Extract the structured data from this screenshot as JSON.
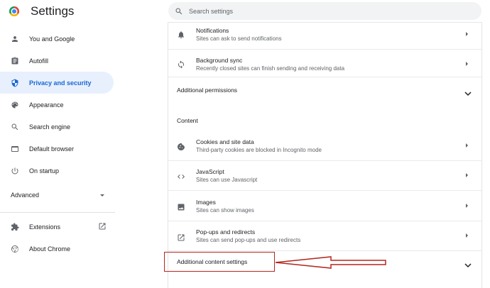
{
  "header": {
    "title": "Settings",
    "search_placeholder": "Search settings"
  },
  "sidebar": {
    "items": [
      {
        "label": "You and Google",
        "icon": "person-icon"
      },
      {
        "label": "Autofill",
        "icon": "clipboard-icon"
      },
      {
        "label": "Privacy and security",
        "icon": "shield-icon",
        "active": true
      },
      {
        "label": "Appearance",
        "icon": "palette-icon"
      },
      {
        "label": "Search engine",
        "icon": "search-icon"
      },
      {
        "label": "Default browser",
        "icon": "browser-icon"
      },
      {
        "label": "On startup",
        "icon": "power-icon"
      }
    ],
    "advanced_label": "Advanced",
    "extensions_label": "Extensions",
    "about_label": "About Chrome"
  },
  "main": {
    "notifications": {
      "title": "Notifications",
      "subtitle": "Sites can ask to send notifications"
    },
    "background_sync": {
      "title": "Background sync",
      "subtitle": "Recently closed sites can finish sending and receiving data"
    },
    "additional_permissions": "Additional permissions",
    "content_heading": "Content",
    "cookies": {
      "title": "Cookies and site data",
      "subtitle": "Third-party cookies are blocked in Incognito mode"
    },
    "javascript": {
      "title": "JavaScript",
      "subtitle": "Sites can use Javascript"
    },
    "images": {
      "title": "Images",
      "subtitle": "Sites can show images"
    },
    "popups": {
      "title": "Pop-ups and redirects",
      "subtitle": "Sites can send pop-ups and use redirects"
    },
    "additional_content": "Additional content settings"
  },
  "colors": {
    "accent": "#1967d2",
    "active_bg": "#e8f0fe",
    "annotation": "#b3261e"
  }
}
